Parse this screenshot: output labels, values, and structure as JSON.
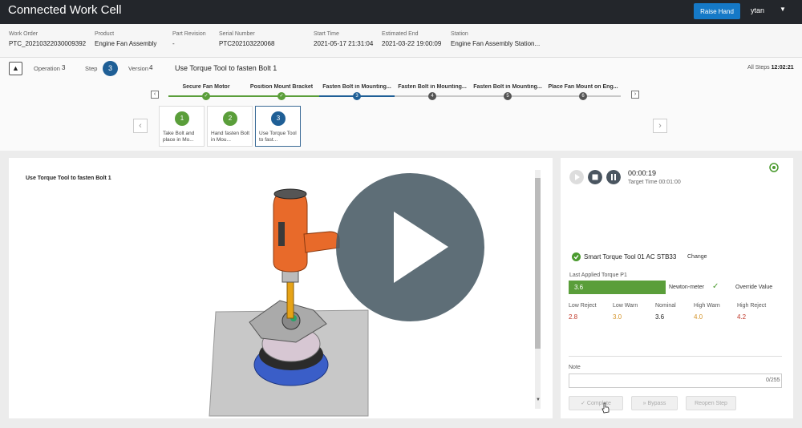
{
  "app": {
    "title": "Connected Work Cell",
    "raise_hand": "Raise Hand",
    "user": "ytan"
  },
  "info": [
    {
      "label": "Work Order",
      "value": "PTC_20210322030009392"
    },
    {
      "label": "Product",
      "value": "Engine Fan Assembly"
    },
    {
      "label": "Part Revision",
      "value": "-"
    },
    {
      "label": "Serial Number",
      "value": "PTC202103220068"
    },
    {
      "label": "Start Time",
      "value": "2021-05-17 21:31:04"
    },
    {
      "label": "Estimated End",
      "value": "2021-03-22 19:00:09"
    },
    {
      "label": "Station",
      "value": "Engine Fan Assembly Station..."
    }
  ],
  "operation": {
    "operation_label": "Operation",
    "operation_num": "3",
    "step_label": "Step",
    "step_num": "3",
    "version_label": "Version",
    "version_num": "4",
    "title": "Use Torque Tool to fasten Bolt 1",
    "all_steps_label": "All Steps",
    "all_steps_time": "12:02:21"
  },
  "progress_steps": [
    {
      "label": "Secure Fan Motor",
      "state": "done",
      "num": ""
    },
    {
      "label": "Position Mount Bracket",
      "state": "done",
      "num": ""
    },
    {
      "label": "Fasten Bolt in Mounting...",
      "state": "current",
      "num": "3"
    },
    {
      "label": "Fasten Bolt in Mounting...",
      "state": "pending",
      "num": "4"
    },
    {
      "label": "Fasten Bolt in Mounting...",
      "state": "pending",
      "num": "5"
    },
    {
      "label": "Place Fan Mount on Eng...",
      "state": "pending",
      "num": "6"
    }
  ],
  "step_cards": [
    {
      "num": "1",
      "text": "Take Bolt and place in Mo...",
      "state": "done"
    },
    {
      "num": "2",
      "text": "Hand fasten Bolt in Mou...",
      "state": "done"
    },
    {
      "num": "3",
      "text": "Use Torque Tool to fast...",
      "state": "current"
    }
  ],
  "viewer": {
    "title": "Use Torque Tool to fasten Bolt 1"
  },
  "panel": {
    "timer": "00:00:19",
    "target": "Target Time 00:01:00",
    "tool": "Smart Torque Tool 01 AC STB33",
    "change": "Change",
    "torque_label": "Last Applied Torque P1",
    "torque_value": "3.6",
    "unit": "Newton-meter",
    "override": "Override Value",
    "limits": [
      {
        "label": "Low Reject",
        "value": "2.8",
        "color": "#c0392b"
      },
      {
        "label": "Low Warn",
        "value": "3.0",
        "color": "#d4942a"
      },
      {
        "label": "Nominal",
        "value": "3.6",
        "color": "#222222"
      },
      {
        "label": "High Warn",
        "value": "4.0",
        "color": "#d4942a"
      },
      {
        "label": "High Reject",
        "value": "4.2",
        "color": "#c0392b"
      }
    ],
    "note_label": "Note",
    "note_count": "0/255",
    "complete": "Complete",
    "bypass": "Bypass",
    "reopen": "Reopen Step"
  },
  "colors": {
    "done": "#5a9e3a",
    "current": "#1f5f96",
    "pending": "#555555",
    "accent": "#1579c7"
  }
}
